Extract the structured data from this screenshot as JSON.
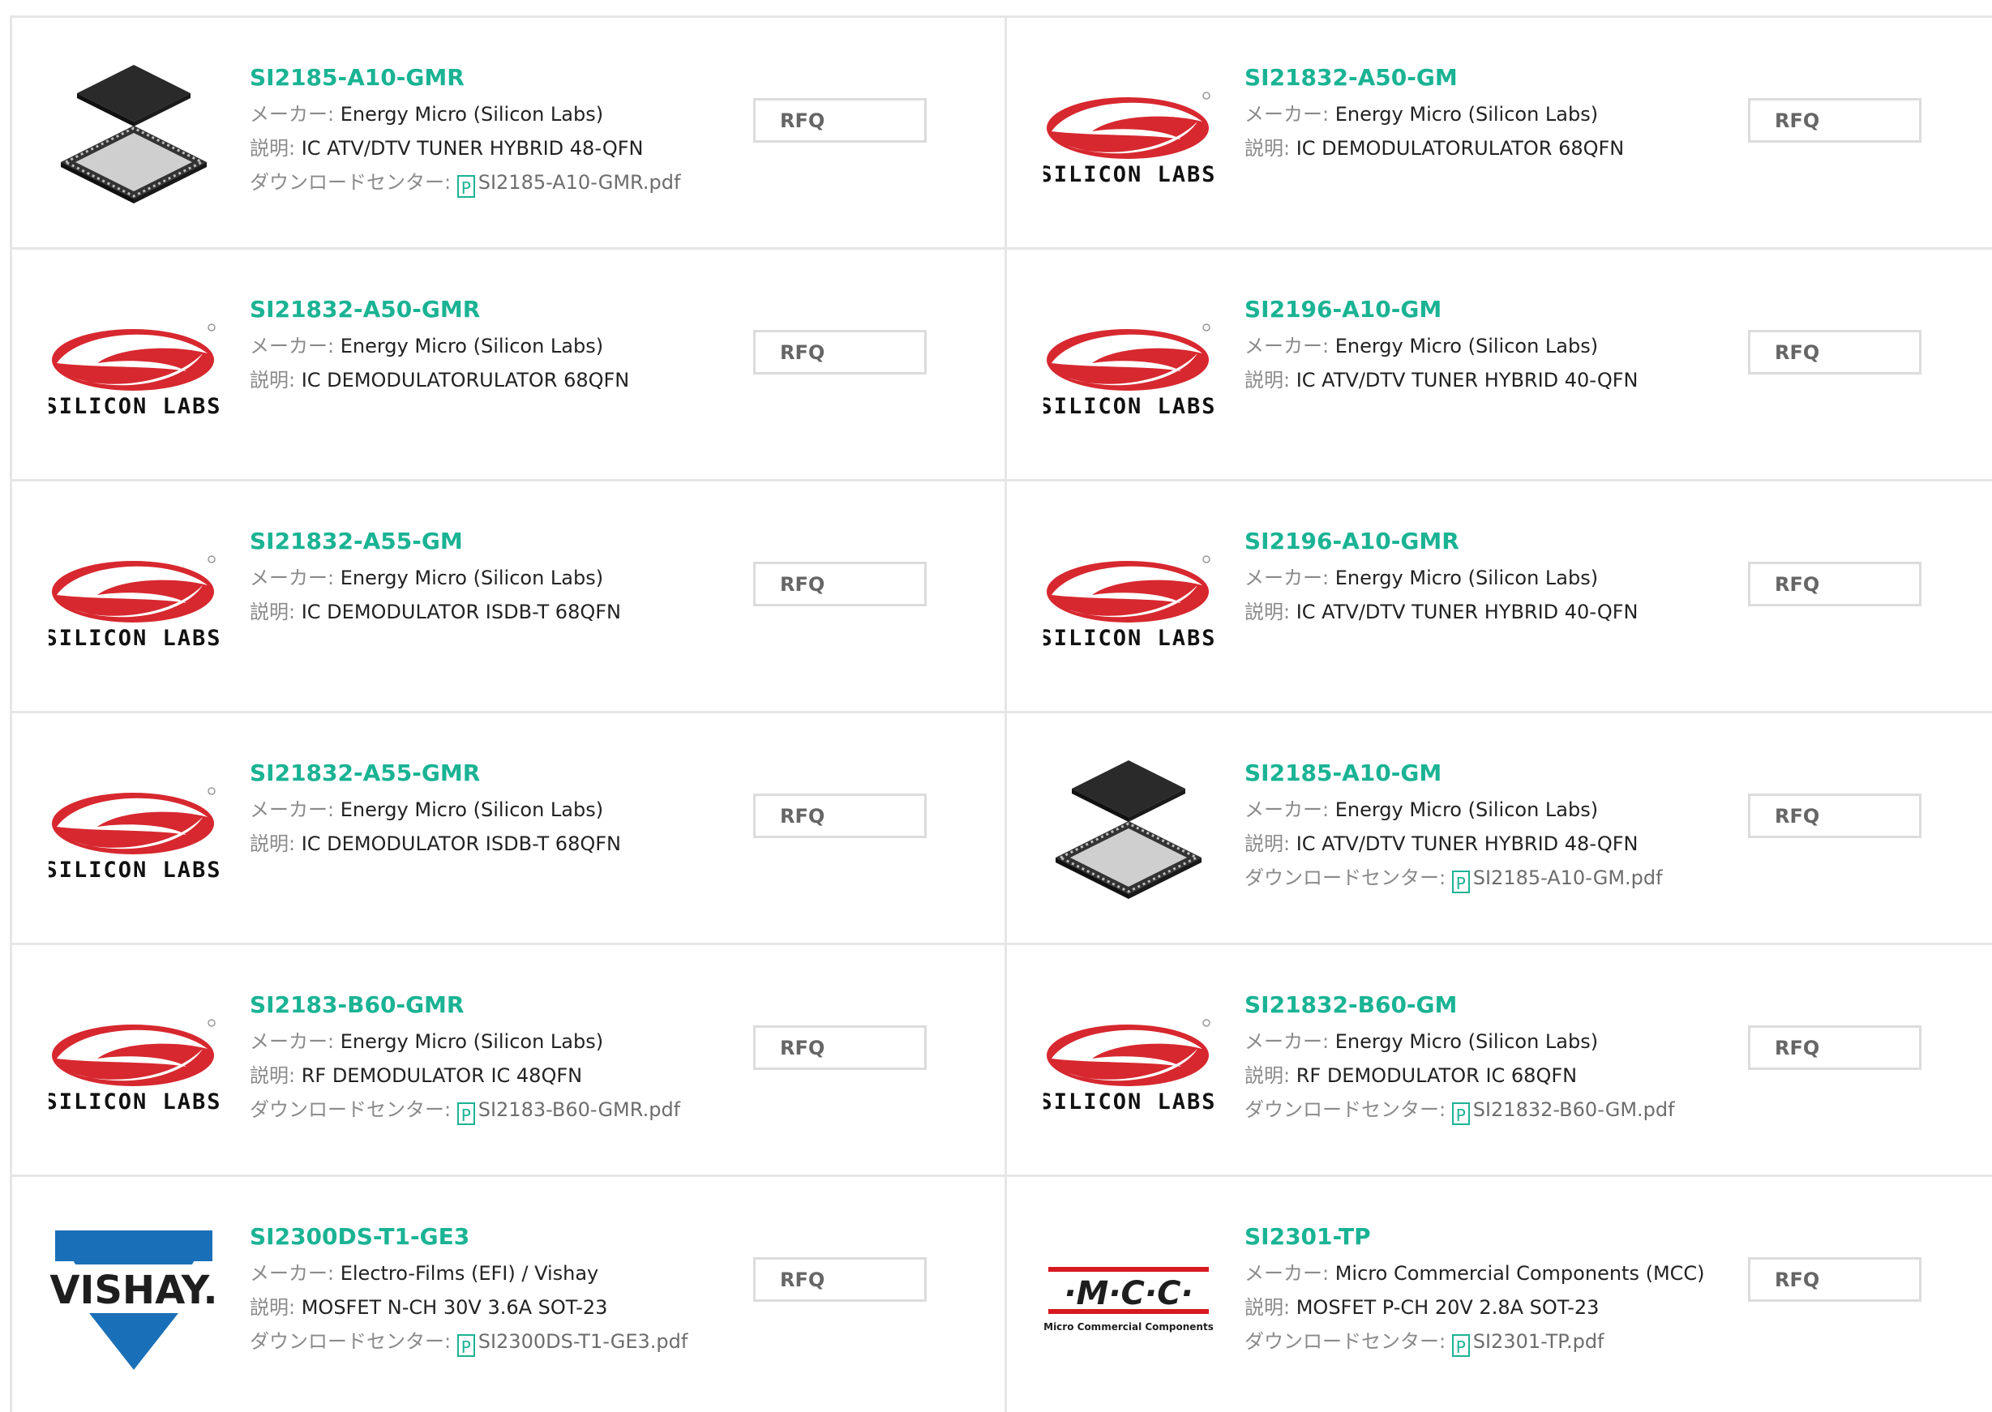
{
  "labels": {
    "maker": "メーカー: ",
    "desc": "説明: ",
    "download": "ダウンロードセンター: ",
    "pdf_icon": "P"
  },
  "logos": {
    "silicon_labs_text": "SILICON LABS",
    "vishay_text": "VISHAY.",
    "mcc_text": "·M·C·C·",
    "mcc_subtitle": "Micro Commercial Components"
  },
  "colors": {
    "accent": "#1ab394",
    "silabs_red": "#d7282f",
    "vishay_blue": "#1a70b8",
    "mcc_red": "#d71920",
    "border": "#e6e6e6"
  },
  "products": [
    {
      "pn": "SI2185-A10-GMR",
      "maker": "Energy Micro (Silicon Labs)",
      "desc": "IC ATV/DTV TUNER HYBRID 48-QFN",
      "pdf": "SI2185-A10-GMR.pdf",
      "logo": "qfn-chip",
      "rfq": "RFQ"
    },
    {
      "pn": "SI21832-A50-GM",
      "maker": "Energy Micro (Silicon Labs)",
      "desc": "IC DEMODULATORULATOR 68QFN",
      "pdf": "",
      "logo": "silicon-labs",
      "rfq": "RFQ"
    },
    {
      "pn": "SI21832-A50-GMR",
      "maker": "Energy Micro (Silicon Labs)",
      "desc": "IC DEMODULATORULATOR 68QFN",
      "pdf": "",
      "logo": "silicon-labs",
      "rfq": "RFQ"
    },
    {
      "pn": "SI2196-A10-GM",
      "maker": "Energy Micro (Silicon Labs)",
      "desc": "IC ATV/DTV TUNER HYBRID 40-QFN",
      "pdf": "",
      "logo": "silicon-labs",
      "rfq": "RFQ"
    },
    {
      "pn": "SI21832-A55-GM",
      "maker": "Energy Micro (Silicon Labs)",
      "desc": "IC DEMODULATOR ISDB-T 68QFN",
      "pdf": "",
      "logo": "silicon-labs",
      "rfq": "RFQ"
    },
    {
      "pn": "SI2196-A10-GMR",
      "maker": "Energy Micro (Silicon Labs)",
      "desc": "IC ATV/DTV TUNER HYBRID 40-QFN",
      "pdf": "",
      "logo": "silicon-labs",
      "rfq": "RFQ"
    },
    {
      "pn": "SI21832-A55-GMR",
      "maker": "Energy Micro (Silicon Labs)",
      "desc": "IC DEMODULATOR ISDB-T 68QFN",
      "pdf": "",
      "logo": "silicon-labs",
      "rfq": "RFQ"
    },
    {
      "pn": "SI2185-A10-GM",
      "maker": "Energy Micro (Silicon Labs)",
      "desc": "IC ATV/DTV TUNER HYBRID 48-QFN",
      "pdf": "SI2185-A10-GM.pdf",
      "logo": "qfn-chip",
      "rfq": "RFQ"
    },
    {
      "pn": "SI2183-B60-GMR",
      "maker": "Energy Micro (Silicon Labs)",
      "desc": "RF DEMODULATOR IC 48QFN",
      "pdf": "SI2183-B60-GMR.pdf",
      "logo": "silicon-labs",
      "rfq": "RFQ"
    },
    {
      "pn": "SI21832-B60-GM",
      "maker": "Energy Micro (Silicon Labs)",
      "desc": "RF DEMODULATOR IC 68QFN",
      "pdf": "SI21832-B60-GM.pdf",
      "logo": "silicon-labs",
      "rfq": "RFQ"
    },
    {
      "pn": "SI2300DS-T1-GE3",
      "maker": "Electro-Films (EFI) / Vishay",
      "desc": "MOSFET N-CH 30V 3.6A SOT-23",
      "pdf": "SI2300DS-T1-GE3.pdf",
      "logo": "vishay",
      "rfq": "RFQ"
    },
    {
      "pn": "SI2301-TP",
      "maker": "Micro Commercial Components (MCC)",
      "desc": "MOSFET P-CH 20V 2.8A SOT-23",
      "pdf": "SI2301-TP.pdf",
      "logo": "mcc",
      "rfq": "RFQ"
    }
  ]
}
